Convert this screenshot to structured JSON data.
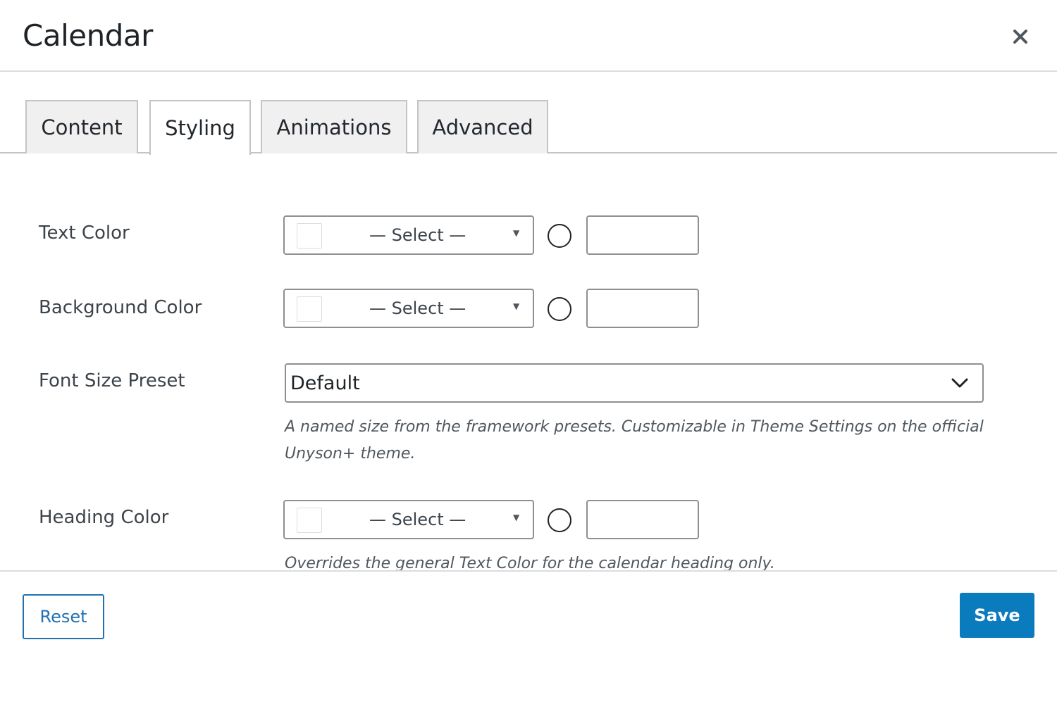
{
  "modal": {
    "title": "Calendar"
  },
  "tabs": [
    {
      "label": "Content",
      "active": false
    },
    {
      "label": "Styling",
      "active": true
    },
    {
      "label": "Animations",
      "active": false
    },
    {
      "label": "Advanced",
      "active": false
    }
  ],
  "fields": {
    "text_color": {
      "label": "Text Color",
      "select_text": "— Select —",
      "hex_value": ""
    },
    "background_color": {
      "label": "Background Color",
      "select_text": "— Select —",
      "hex_value": ""
    },
    "font_size_preset": {
      "label": "Font Size Preset",
      "value": "Default",
      "help": "A named size from the framework presets. Customizable in Theme Settings on the official Unyson+ theme."
    },
    "heading_color": {
      "label": "Heading Color",
      "select_text": "— Select —",
      "hex_value": "",
      "help": "Overrides the general Text Color for the calendar heading only."
    }
  },
  "footer": {
    "reset_label": "Reset",
    "save_label": "Save"
  },
  "colors": {
    "accent": "#2271b1",
    "save_bg": "#0a7bbd"
  },
  "icons": {
    "close": "close-icon",
    "dropdown": "chevron-down-icon",
    "caret": "caret-down-icon"
  }
}
